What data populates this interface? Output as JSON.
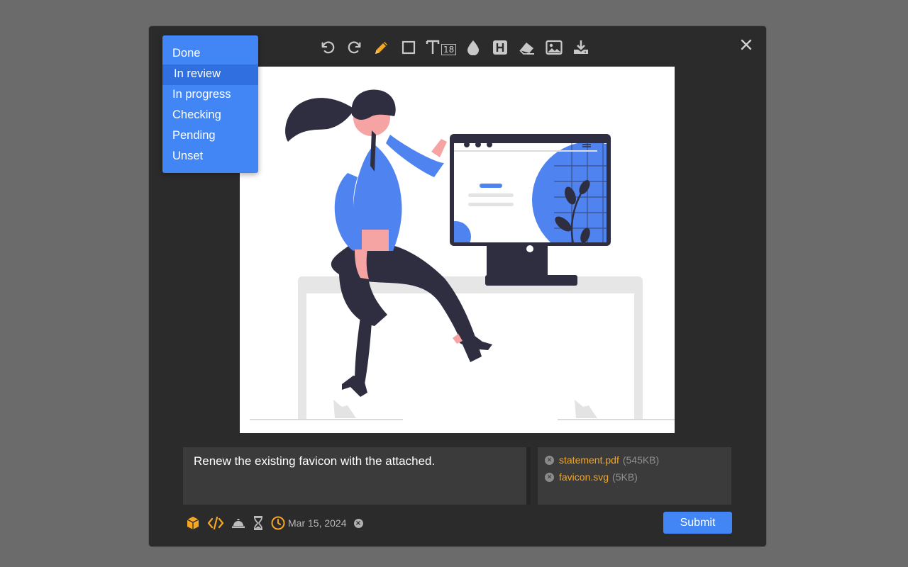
{
  "toolbar": {
    "tools": [
      "undo-icon",
      "redo-icon",
      "pencil-icon",
      "rectangle-icon",
      "text-icon",
      "blur-icon",
      "highlight-icon",
      "eraser-icon",
      "image-icon",
      "download-icon"
    ],
    "font_size": "18",
    "active_tool_color": "#f5a623"
  },
  "dropdown": {
    "items": [
      "Done",
      "In review",
      "In progress",
      "Checking",
      "Pending",
      "Unset"
    ],
    "selected": "In review",
    "color": "#4285f4"
  },
  "comment": {
    "text": "Renew the existing favicon with the attached."
  },
  "attachments": [
    {
      "name": "statement.pdf",
      "size": "(545KB)"
    },
    {
      "name": "favicon.svg",
      "size": "(5KB)"
    }
  ],
  "footer": {
    "icons": [
      "box-icon",
      "code-icon",
      "bell-icon",
      "hourglass-icon",
      "clock-icon"
    ],
    "date": "Mar 15, 2024"
  },
  "submit_label": "Submit"
}
